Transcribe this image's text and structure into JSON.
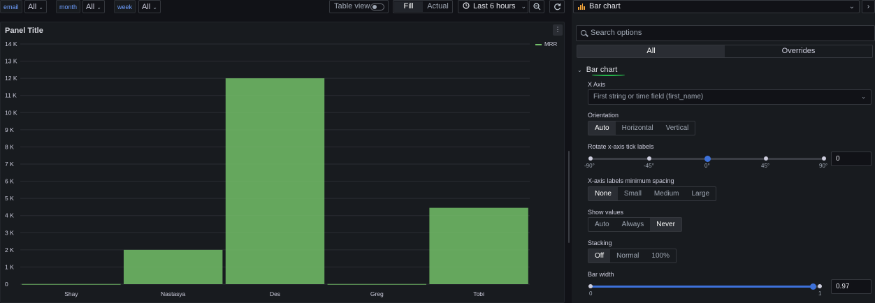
{
  "variables": [
    {
      "label": "email",
      "value": "All"
    },
    {
      "label": "month",
      "value": "All"
    },
    {
      "label": "week",
      "value": "All"
    }
  ],
  "toolbar": {
    "table_view": "Table view",
    "fill": "Fill",
    "actual": "Actual",
    "time_range": "Last 6 hours",
    "chevron": "⌄",
    "zoom_out_icon": "zoom-out-icon",
    "refresh_icon": "refresh-icon"
  },
  "panel": {
    "title": "Panel Title",
    "menu": "⋮"
  },
  "chart_data": {
    "type": "bar",
    "categories": [
      "Shay",
      "Nastasya",
      "Des",
      "Greg",
      "Tobi"
    ],
    "series": [
      {
        "name": "MRR",
        "values": [
          10,
          2000,
          12000,
          10,
          4450
        ],
        "color": "#73bf69"
      }
    ],
    "ylim": [
      0,
      14000
    ],
    "yticks": [
      "0",
      "1 K",
      "2 K",
      "3 K",
      "4 K",
      "5 K",
      "6 K",
      "7 K",
      "8 K",
      "9 K",
      "10 K",
      "11 K",
      "12 K",
      "13 K",
      "14 K"
    ],
    "grid": true,
    "legend": "top-right"
  },
  "options": {
    "viz_name": "Bar chart",
    "search_placeholder": "Search options",
    "tabs": [
      "All",
      "Overrides"
    ],
    "section": "Bar chart",
    "x_axis": {
      "label": "X Axis",
      "value": "First string or time field (first_name)"
    },
    "orientation": {
      "label": "Orientation",
      "options": [
        "Auto",
        "Horizontal",
        "Vertical"
      ],
      "selected": "Auto"
    },
    "rotate": {
      "label": "Rotate x-axis tick labels",
      "ticks": [
        "-90°",
        "-45°",
        "0°",
        "45°",
        "90°"
      ],
      "value": "0"
    },
    "min_spacing": {
      "label": "X-axis labels minimum spacing",
      "options": [
        "None",
        "Small",
        "Medium",
        "Large"
      ],
      "selected": "None"
    },
    "show_values": {
      "label": "Show values",
      "options": [
        "Auto",
        "Always",
        "Never"
      ],
      "selected": "Never"
    },
    "stacking": {
      "label": "Stacking",
      "options": [
        "Off",
        "Normal",
        "100%"
      ],
      "selected": "Off"
    },
    "bar_width": {
      "label": "Bar width",
      "min": "0",
      "max": "1",
      "value": "0.97"
    }
  }
}
